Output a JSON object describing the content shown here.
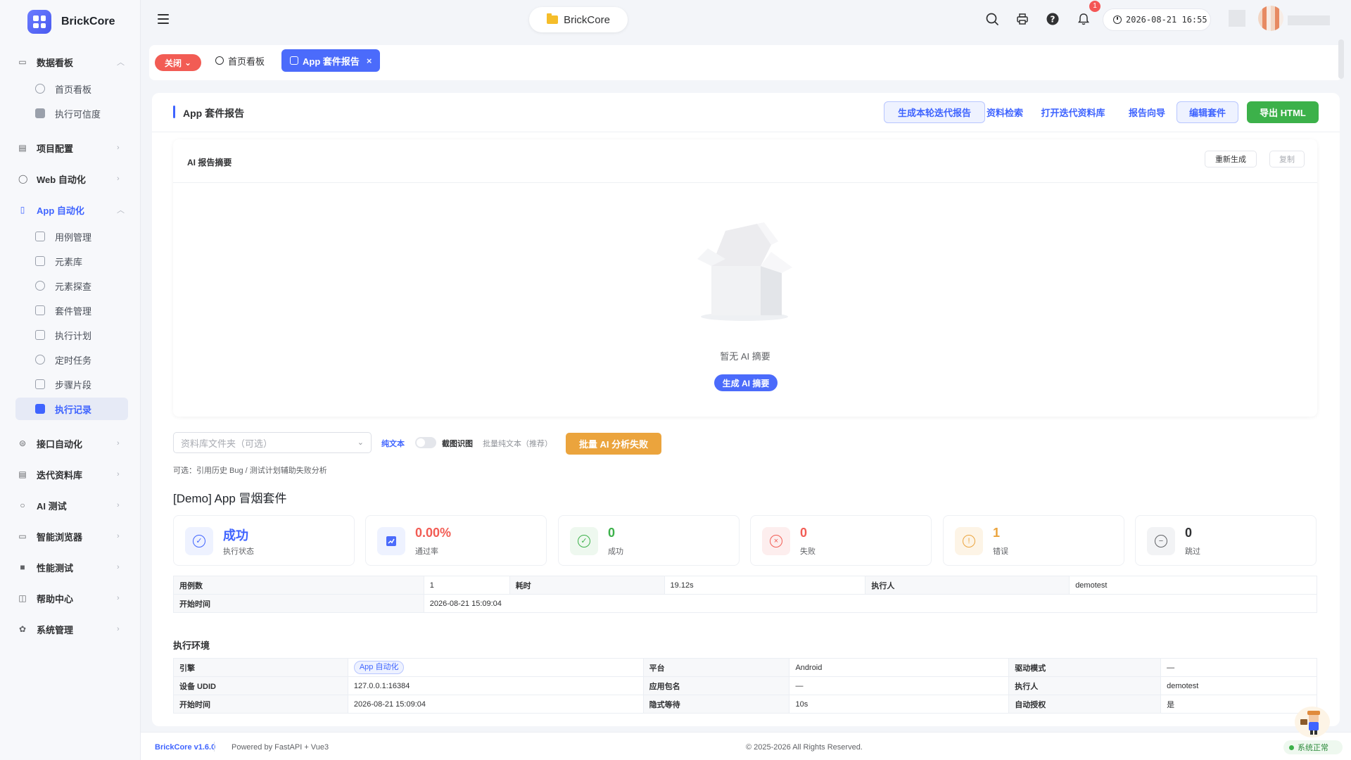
{
  "app": {
    "name": "BrickCore"
  },
  "sidebar": {
    "groups": [
      {
        "label": "数据看板",
        "icon": "dashboard-icon",
        "expanded": true
      },
      {
        "label": "项目配置",
        "icon": "project-icon",
        "expanded": false
      },
      {
        "label": "Web 自动化",
        "icon": "web-icon",
        "expanded": false
      },
      {
        "label": "App 自动化",
        "icon": "mobile-icon",
        "expanded": true,
        "active": true
      },
      {
        "label": "接口自动化",
        "icon": "api-icon",
        "expanded": false
      },
      {
        "label": "迭代资料库",
        "icon": "library-icon",
        "expanded": false
      },
      {
        "label": "AI 测试",
        "icon": "ai-icon",
        "expanded": false
      },
      {
        "label": "智能浏览器",
        "icon": "browser-icon",
        "expanded": false
      },
      {
        "label": "性能测试",
        "icon": "performance-icon",
        "expanded": false
      },
      {
        "label": "帮助中心",
        "icon": "help-book-icon",
        "expanded": false
      },
      {
        "label": "系统管理",
        "icon": "settings-icon",
        "expanded": false
      }
    ],
    "dashboard_items": [
      "首页看板",
      "执行可信度"
    ],
    "app_items": [
      "用例管理",
      "元素库",
      "元素探查",
      "套件管理",
      "执行计划",
      "定时任务",
      "步骤片段",
      "执行记录"
    ],
    "active_item": "执行记录"
  },
  "header": {
    "project": "BrickCore",
    "notification_count": "1",
    "datetime": "2026-08-21 16:55"
  },
  "tabs": {
    "close_label": "关闭",
    "items": [
      {
        "label": "首页看板",
        "active": false
      },
      {
        "label": "App 套件报告",
        "active": true
      }
    ]
  },
  "main": {
    "title": "App 套件报告",
    "buttons": {
      "gen_iteration_report": "生成本轮迭代报告",
      "search_docs": "资料检索",
      "open_library": "打开迭代资料库",
      "report_wizard": "报告向导",
      "edit_suite": "编辑套件",
      "export_html": "导出 HTML"
    }
  },
  "ai_summary": {
    "title": "AI 报告摘要",
    "regenerate": "重新生成",
    "copy": "复制",
    "empty_text": "暂无 AI 摘要",
    "generate": "生成 AI 摘要"
  },
  "controls": {
    "folder_placeholder": "资料库文件夹（可选）",
    "plain_text": "纯文本",
    "screenshot_ocr": "截图识图",
    "batch_hint": "批量纯文本（推荐）",
    "batch_button": "批量 AI 分析失败",
    "hint": "可选：引用历史 Bug / 测试计划辅助失败分析"
  },
  "suite": {
    "name": "[Demo] App 冒烟套件",
    "stats": [
      {
        "value": "成功",
        "label": "执行状态",
        "color": "#3f64ff",
        "icon": "check-circle-icon",
        "bg": "#eef2ff"
      },
      {
        "value": "0.00%",
        "label": "通过率",
        "color": "#f25c54",
        "icon": "trend-chart-icon",
        "bg": "#eef2ff"
      },
      {
        "value": "0",
        "label": "成功",
        "color": "#3cb14a",
        "icon": "success-icon",
        "bg": "#eef8ef"
      },
      {
        "value": "0",
        "label": "失败",
        "color": "#f25c54",
        "icon": "fail-icon",
        "bg": "#fdeeee"
      },
      {
        "value": "1",
        "label": "错误",
        "color": "#eba43d",
        "icon": "warning-icon",
        "bg": "#fdf4e6"
      },
      {
        "value": "0",
        "label": "跳过",
        "color": "#303133",
        "icon": "skip-icon",
        "bg": "#f2f3f5"
      }
    ],
    "summary": {
      "cases_label": "用例数",
      "cases": "1",
      "duration_label": "耗时",
      "duration": "19.12s",
      "executor_label": "执行人",
      "executor": "demotest",
      "start_label": "开始时间",
      "start": "2026-08-21 15:09:04"
    }
  },
  "environment": {
    "title": "执行环境",
    "rows": [
      [
        "引擎",
        "App 自动化",
        "平台",
        "Android",
        "驱动模式",
        "—"
      ],
      [
        "设备 UDID",
        "127.0.0.1:16384",
        "应用包名",
        "—",
        "执行人",
        "demotest"
      ],
      [
        "开始时间",
        "2026-08-21 15:09:04",
        "隐式等待",
        "10s",
        "自动授权",
        "是"
      ]
    ]
  },
  "footer": {
    "version": "BrickCore v1.6.0",
    "powered": "Powered by FastAPI + Vue3",
    "copyright": "© 2025-2026 All Rights Reserved.",
    "status": "系统正常"
  }
}
